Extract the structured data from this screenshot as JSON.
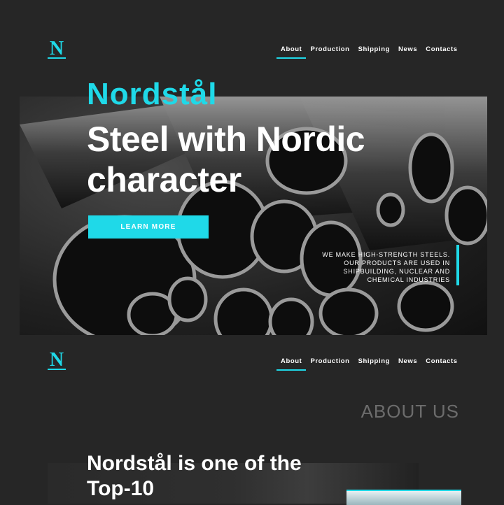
{
  "header": {
    "logo_letter": "N",
    "nav": [
      "About",
      "Production",
      "Shipping",
      "News",
      "Contacts"
    ]
  },
  "hero": {
    "brand": "Nordstål",
    "title": "Steel with Nordic character",
    "cta_label": "LEARN MORE",
    "tagline": "WE MAKE HIGH-STRENGTH STEELS. OUR PRODUCTS ARE USED IN SHIPBUILDING, NUCLEAR AND CHEMICAL INDUSTRIES"
  },
  "about": {
    "heading": "ABOUT US",
    "intro": "Nordstål is one of the Top-10"
  },
  "colors": {
    "accent": "#1fd9e8",
    "background": "#262626"
  }
}
